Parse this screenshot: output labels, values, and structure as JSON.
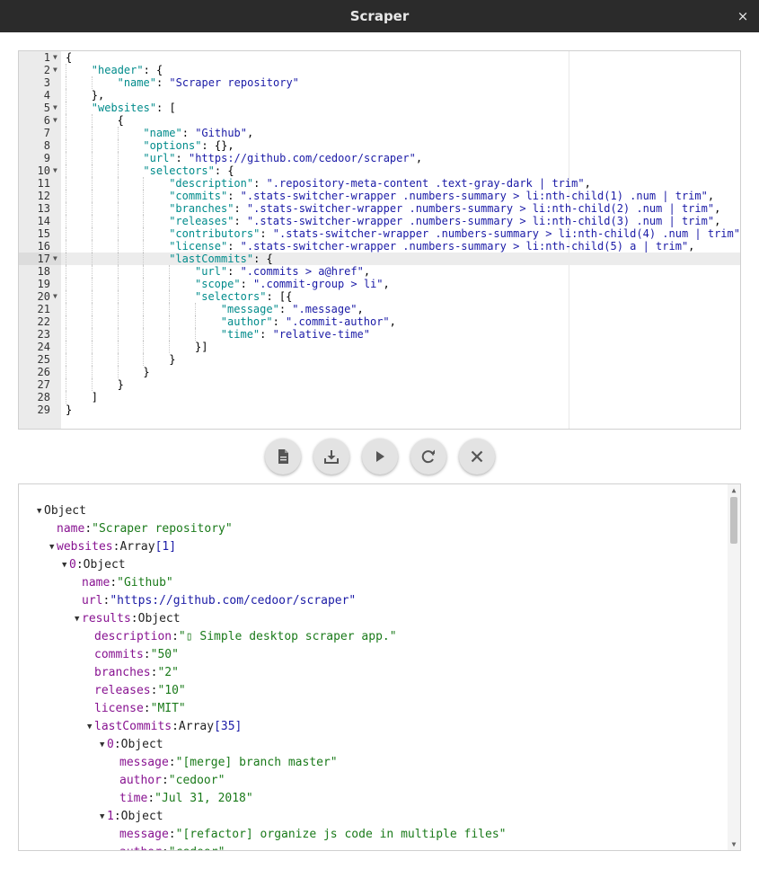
{
  "window": {
    "title": "Scraper",
    "close_glyph": "×"
  },
  "editor": {
    "lines": [
      {
        "n": "1",
        "fold": true,
        "indent": 0,
        "tokens": [
          [
            "p",
            "{"
          ]
        ]
      },
      {
        "n": "2",
        "fold": true,
        "indent": 1,
        "tokens": [
          [
            "k",
            "\"header\""
          ],
          [
            "p",
            ": {"
          ]
        ]
      },
      {
        "n": "3",
        "indent": 2,
        "tokens": [
          [
            "k",
            "\"name\""
          ],
          [
            "p",
            ": "
          ],
          [
            "s",
            "\"Scraper repository\""
          ]
        ]
      },
      {
        "n": "4",
        "indent": 1,
        "tokens": [
          [
            "p",
            "},"
          ]
        ]
      },
      {
        "n": "5",
        "fold": true,
        "indent": 1,
        "tokens": [
          [
            "k",
            "\"websites\""
          ],
          [
            "p",
            ": ["
          ]
        ]
      },
      {
        "n": "6",
        "fold": true,
        "indent": 2,
        "tokens": [
          [
            "p",
            "{"
          ]
        ]
      },
      {
        "n": "7",
        "indent": 3,
        "tokens": [
          [
            "k",
            "\"name\""
          ],
          [
            "p",
            ": "
          ],
          [
            "s",
            "\"Github\""
          ],
          [
            "p",
            ","
          ]
        ]
      },
      {
        "n": "8",
        "indent": 3,
        "tokens": [
          [
            "k",
            "\"options\""
          ],
          [
            "p",
            ": {},"
          ]
        ]
      },
      {
        "n": "9",
        "indent": 3,
        "tokens": [
          [
            "k",
            "\"url\""
          ],
          [
            "p",
            ": "
          ],
          [
            "s",
            "\"https://github.com/cedoor/scraper\""
          ],
          [
            "p",
            ","
          ]
        ]
      },
      {
        "n": "10",
        "fold": true,
        "indent": 3,
        "tokens": [
          [
            "k",
            "\"selectors\""
          ],
          [
            "p",
            ": {"
          ]
        ]
      },
      {
        "n": "11",
        "indent": 4,
        "tokens": [
          [
            "k",
            "\"description\""
          ],
          [
            "p",
            ": "
          ],
          [
            "s",
            "\".repository-meta-content .text-gray-dark | trim\""
          ],
          [
            "p",
            ","
          ]
        ]
      },
      {
        "n": "12",
        "indent": 4,
        "tokens": [
          [
            "k",
            "\"commits\""
          ],
          [
            "p",
            ": "
          ],
          [
            "s",
            "\".stats-switcher-wrapper .numbers-summary > li:nth-child(1) .num | trim\""
          ],
          [
            "p",
            ","
          ]
        ]
      },
      {
        "n": "13",
        "indent": 4,
        "tokens": [
          [
            "k",
            "\"branches\""
          ],
          [
            "p",
            ": "
          ],
          [
            "s",
            "\".stats-switcher-wrapper .numbers-summary > li:nth-child(2) .num | trim\""
          ],
          [
            "p",
            ","
          ]
        ]
      },
      {
        "n": "14",
        "indent": 4,
        "tokens": [
          [
            "k",
            "\"releases\""
          ],
          [
            "p",
            ": "
          ],
          [
            "s",
            "\".stats-switcher-wrapper .numbers-summary > li:nth-child(3) .num | trim\""
          ],
          [
            "p",
            ","
          ]
        ]
      },
      {
        "n": "15",
        "indent": 4,
        "tokens": [
          [
            "k",
            "\"contributors\""
          ],
          [
            "p",
            ": "
          ],
          [
            "s",
            "\".stats-switcher-wrapper .numbers-summary > li:nth-child(4) .num | trim\""
          ],
          [
            "p",
            ","
          ]
        ]
      },
      {
        "n": "16",
        "indent": 4,
        "tokens": [
          [
            "k",
            "\"license\""
          ],
          [
            "p",
            ": "
          ],
          [
            "s",
            "\".stats-switcher-wrapper .numbers-summary > li:nth-child(5) a | trim\""
          ],
          [
            "p",
            ","
          ]
        ]
      },
      {
        "n": "17",
        "fold": true,
        "active": true,
        "indent": 4,
        "tokens": [
          [
            "k",
            "\"lastCommits\""
          ],
          [
            "p",
            ": {"
          ]
        ]
      },
      {
        "n": "18",
        "indent": 5,
        "tokens": [
          [
            "k",
            "\"url\""
          ],
          [
            "p",
            ": "
          ],
          [
            "s",
            "\".commits > a@href\""
          ],
          [
            "p",
            ","
          ]
        ]
      },
      {
        "n": "19",
        "indent": 5,
        "tokens": [
          [
            "k",
            "\"scope\""
          ],
          [
            "p",
            ": "
          ],
          [
            "s",
            "\".commit-group > li\""
          ],
          [
            "p",
            ","
          ]
        ]
      },
      {
        "n": "20",
        "fold": true,
        "indent": 5,
        "tokens": [
          [
            "k",
            "\"selectors\""
          ],
          [
            "p",
            ": [{"
          ]
        ]
      },
      {
        "n": "21",
        "indent": 6,
        "tokens": [
          [
            "k",
            "\"message\""
          ],
          [
            "p",
            ": "
          ],
          [
            "s",
            "\".message\""
          ],
          [
            "p",
            ","
          ]
        ]
      },
      {
        "n": "22",
        "indent": 6,
        "tokens": [
          [
            "k",
            "\"author\""
          ],
          [
            "p",
            ": "
          ],
          [
            "s",
            "\".commit-author\""
          ],
          [
            "p",
            ","
          ]
        ]
      },
      {
        "n": "23",
        "indent": 6,
        "tokens": [
          [
            "k",
            "\"time\""
          ],
          [
            "p",
            ": "
          ],
          [
            "s",
            "\"relative-time\""
          ]
        ]
      },
      {
        "n": "24",
        "indent": 5,
        "tokens": [
          [
            "p",
            "}]"
          ]
        ]
      },
      {
        "n": "25",
        "indent": 4,
        "tokens": [
          [
            "p",
            "}"
          ]
        ]
      },
      {
        "n": "26",
        "indent": 3,
        "tokens": [
          [
            "p",
            "}"
          ]
        ]
      },
      {
        "n": "27",
        "indent": 2,
        "tokens": [
          [
            "p",
            "}"
          ]
        ]
      },
      {
        "n": "28",
        "indent": 1,
        "tokens": [
          [
            "p",
            "]"
          ]
        ]
      },
      {
        "n": "29",
        "indent": 0,
        "tokens": [
          [
            "p",
            "}"
          ]
        ]
      }
    ]
  },
  "toolbar": {
    "buttons": [
      {
        "name": "new-file-button",
        "icon": "file-icon"
      },
      {
        "name": "download-button",
        "icon": "download-icon"
      },
      {
        "name": "run-button",
        "icon": "play-icon"
      },
      {
        "name": "reload-button",
        "icon": "refresh-icon"
      },
      {
        "name": "clear-button",
        "icon": "close-icon"
      }
    ]
  },
  "results": {
    "rows": [
      {
        "d": 0,
        "tw": "▼",
        "key": "",
        "type": "Object"
      },
      {
        "d": 1,
        "key": "name",
        "val": "\"Scraper repository\""
      },
      {
        "d": 1,
        "tw": "▼",
        "key": "websites",
        "type": "Array",
        "len": "[1]"
      },
      {
        "d": 2,
        "tw": "▼",
        "key": "0",
        "type": "Object"
      },
      {
        "d": 3,
        "key": "name",
        "val": "\"Github\""
      },
      {
        "d": 3,
        "key": "url",
        "link": "\"https://github.com/cedoor/scraper\""
      },
      {
        "d": 3,
        "tw": "▼",
        "key": "results",
        "type": "Object"
      },
      {
        "d": 4,
        "key": "description",
        "val": "\"▯ Simple desktop scraper app.\""
      },
      {
        "d": 4,
        "key": "commits",
        "val": "\"50\""
      },
      {
        "d": 4,
        "key": "branches",
        "val": "\"2\""
      },
      {
        "d": 4,
        "key": "releases",
        "val": "\"10\""
      },
      {
        "d": 4,
        "key": "license",
        "val": "\"MIT\""
      },
      {
        "d": 4,
        "tw": "▼",
        "key": "lastCommits",
        "type": "Array",
        "len": "[35]"
      },
      {
        "d": 5,
        "tw": "▼",
        "key": "0",
        "type": "Object"
      },
      {
        "d": 6,
        "key": "message",
        "val": "\"[merge] branch master\""
      },
      {
        "d": 6,
        "key": "author",
        "val": "\"cedoor\""
      },
      {
        "d": 6,
        "key": "time",
        "val": "\"Jul 31, 2018\""
      },
      {
        "d": 5,
        "tw": "▼",
        "key": "1",
        "type": "Object"
      },
      {
        "d": 6,
        "key": "message",
        "val": "\"[refactor] organize js code in multiple files\""
      },
      {
        "d": 6,
        "key": "author",
        "val": "\"cedoor\""
      }
    ]
  },
  "scrollbar": {
    "up_glyph": "▲",
    "down_glyph": "▼"
  }
}
